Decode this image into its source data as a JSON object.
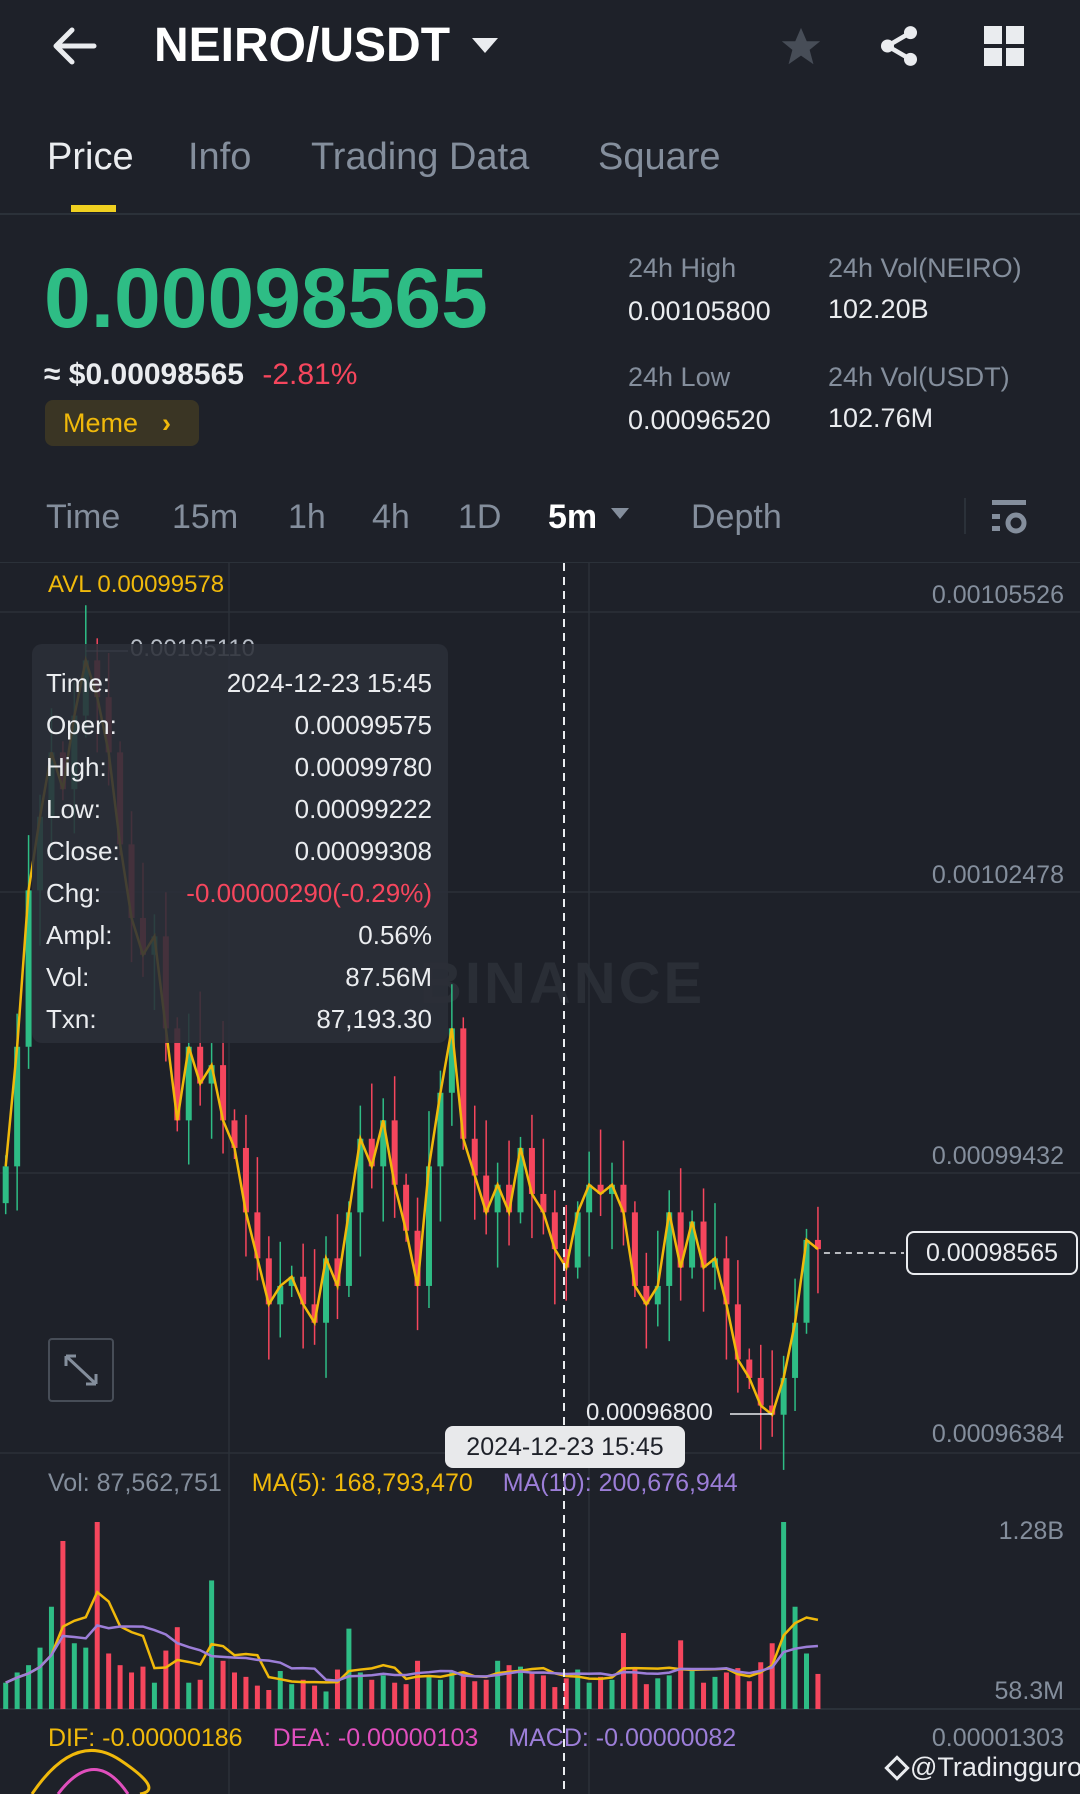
{
  "header": {
    "title": "NEIRO/USDT"
  },
  "tabs": [
    {
      "label": "Price"
    },
    {
      "label": "Info"
    },
    {
      "label": "Trading Data"
    },
    {
      "label": "Square"
    }
  ],
  "ticker": {
    "price": "0.00098565",
    "usd_price": "≈ $0.00098565",
    "change": "-2.81%",
    "tag": "Meme",
    "tag_arrow": "›",
    "high_label": "24h High",
    "high": "0.00105800",
    "low_label": "24h Low",
    "low": "0.00096520",
    "vol_base_label": "24h Vol(NEIRO)",
    "vol_base": "102.20B",
    "vol_quote_label": "24h Vol(USDT)",
    "vol_quote": "102.76M"
  },
  "intervals": {
    "time": "Time",
    "i15m": "15m",
    "i1h": "1h",
    "i4h": "4h",
    "i1d": "1D",
    "selected": "5m",
    "depth": "Depth"
  },
  "colors": {
    "up": "#2ebd85",
    "down": "#f6465d",
    "accent": "#f0b90b",
    "ma10": "#9c7ed8",
    "dea": "#e04fbd"
  },
  "chart": {
    "avl": "AVL 0.00099578",
    "axis_labels": [
      "0.00105526",
      "0.00102478",
      "0.00099432",
      "0.00096384"
    ],
    "max_label": "0.00105110",
    "min_label": "0.00096800",
    "last_price": "0.00098565",
    "watermark": "BINANCE",
    "crosshair_time": "2024-12-23 15:45",
    "tooltip": [
      {
        "label": "Time:",
        "value": "2024-12-23 15:45"
      },
      {
        "label": "Open:",
        "value": "0.00099575"
      },
      {
        "label": "High:",
        "value": "0.00099780"
      },
      {
        "label": "Low:",
        "value": "0.00099222"
      },
      {
        "label": "Close:",
        "value": "0.00099308"
      },
      {
        "label": "Chg:",
        "value": "-0.00000290(-0.29%)"
      },
      {
        "label": "Ampl:",
        "value": "0.56%"
      },
      {
        "label": "Vol:",
        "value": "87.56M"
      },
      {
        "label": "Txn:",
        "value": "87,193.30"
      }
    ],
    "volume": {
      "vol": "Vol: 87,562,751",
      "ma5": "MA(5): 168,793,470",
      "ma10": "MA(10): 200,676,944",
      "axis_top": "1.28B",
      "axis_bottom": "58.3M"
    },
    "macd": {
      "dif": "DIF: -0.00000186",
      "dea": "DEA: -0.00000103",
      "macd": "MACD: -0.00000082",
      "axis": "0.00001303"
    }
  },
  "watermark_credit": "@Tradingguro",
  "chart_data": {
    "type": "candlestick",
    "interval": "5m",
    "ylim": [
      0.00096384,
      0.00105526
    ],
    "closes": [
      0.000995,
      0.001008,
      0.001025,
      0.001033,
      0.00104,
      0.001036,
      0.001044,
      0.00105,
      0.001046,
      0.00104,
      0.00103,
      0.001022,
      0.001018,
      0.00102,
      0.00101,
      0.001,
      0.001008,
      0.001004,
      0.001006,
      0.001,
      0.000997,
      0.00099,
      0.000985,
      0.00098,
      0.000982,
      0.000983,
      0.00098,
      0.000978,
      0.000985,
      0.000982,
      0.00099,
      0.000998,
      0.000995,
      0.001,
      0.000993,
      0.000988,
      0.000982,
      0.000995,
      0.001003,
      0.00101,
      0.000998,
      0.000994,
      0.00099,
      0.000993,
      0.00099,
      0.000997,
      0.000992,
      0.00099,
      0.000986,
      0.000984,
      0.00099,
      0.000993,
      0.000992,
      0.000993,
      0.00099,
      0.000982,
      0.00098,
      0.000982,
      0.00099,
      0.000984,
      0.000989,
      0.000984,
      0.000985,
      0.00098,
      0.000974,
      0.000972,
      0.000969,
      0.000968,
      0.000972,
      0.000978,
      0.000987,
      0.000986
    ],
    "volumes_millions": [
      180,
      250,
      300,
      420,
      700,
      1150,
      450,
      420,
      1280,
      380,
      300,
      250,
      290,
      180,
      400,
      560,
      180,
      200,
      880,
      330,
      250,
      220,
      160,
      130,
      260,
      170,
      200,
      160,
      120,
      270,
      550,
      250,
      200,
      230,
      180,
      170,
      330,
      220,
      200,
      260,
      250,
      190,
      200,
      330,
      300,
      290,
      250,
      230,
      150,
      210,
      270,
      180,
      220,
      200,
      520,
      280,
      170,
      210,
      230,
      470,
      260,
      180,
      220,
      250,
      280,
      190,
      320,
      450,
      1280,
      700,
      380,
      240
    ],
    "volume_max_millions": 1280
  }
}
